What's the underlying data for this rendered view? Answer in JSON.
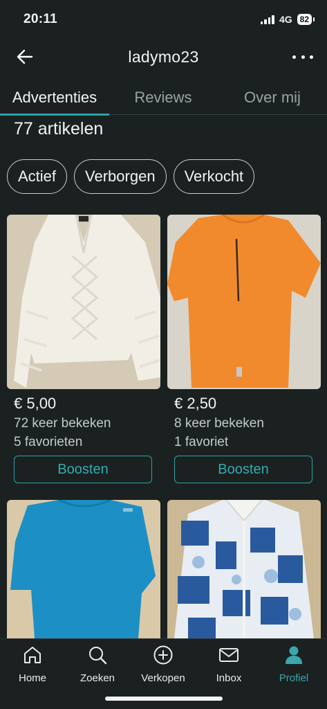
{
  "status_bar": {
    "time": "20:11",
    "network": "4G",
    "battery": "82"
  },
  "header": {
    "title": "ladymo23"
  },
  "tabs": [
    {
      "label": "Advertenties",
      "active": true
    },
    {
      "label": "Reviews",
      "active": false
    },
    {
      "label": "Over mij",
      "active": false
    }
  ],
  "listing": {
    "count_label": "77 artikelen"
  },
  "filters": [
    {
      "label": "Actief"
    },
    {
      "label": "Verborgen"
    },
    {
      "label": "Verkocht"
    }
  ],
  "items": [
    {
      "price": "€ 5,00",
      "views": "72 keer bekeken",
      "favorites": "5 favorieten",
      "boost_label": "Boosten",
      "image": "white-knit-sweater"
    },
    {
      "price": "€ 2,50",
      "views": "8 keer bekeken",
      "favorites": "1 favoriet",
      "boost_label": "Boosten",
      "image": "orange-tshirt"
    },
    {
      "image": "blue-tshirt"
    },
    {
      "image": "blue-paisley-blouse"
    }
  ],
  "bottom_nav": [
    {
      "label": "Home",
      "icon": "home-icon"
    },
    {
      "label": "Zoeken",
      "icon": "search-icon"
    },
    {
      "label": "Verkopen",
      "icon": "plus-circle-icon"
    },
    {
      "label": "Inbox",
      "icon": "mail-icon"
    },
    {
      "label": "Profiel",
      "icon": "profile-icon",
      "active": true
    }
  ],
  "colors": {
    "background": "#1b2121",
    "accent": "#2fa2a8",
    "text": "#f2f4f4",
    "muted": "#c4cbcb"
  }
}
